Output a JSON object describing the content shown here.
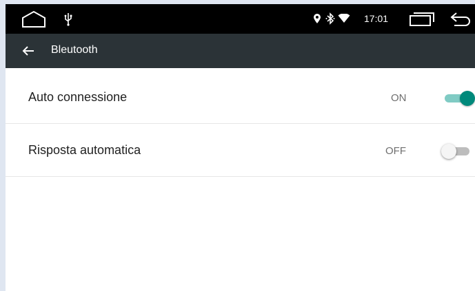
{
  "status_bar": {
    "time": "17:01",
    "icons": [
      "home-icon",
      "usb-icon",
      "location-icon",
      "bluetooth-icon",
      "wifi-icon",
      "recent-apps-icon",
      "back-icon"
    ]
  },
  "app_bar": {
    "title": "Bleutooth",
    "back_icon": "arrow-back-icon"
  },
  "settings": [
    {
      "label": "Auto connessione",
      "state_text": "ON",
      "enabled": true
    },
    {
      "label": "Risposta automatica",
      "state_text": "OFF",
      "enabled": false
    }
  ],
  "colors": {
    "status_bar_bg": "#000000",
    "app_bar_bg": "#2b3337",
    "accent": "#00897b",
    "accent_track": "#80cbc4"
  }
}
